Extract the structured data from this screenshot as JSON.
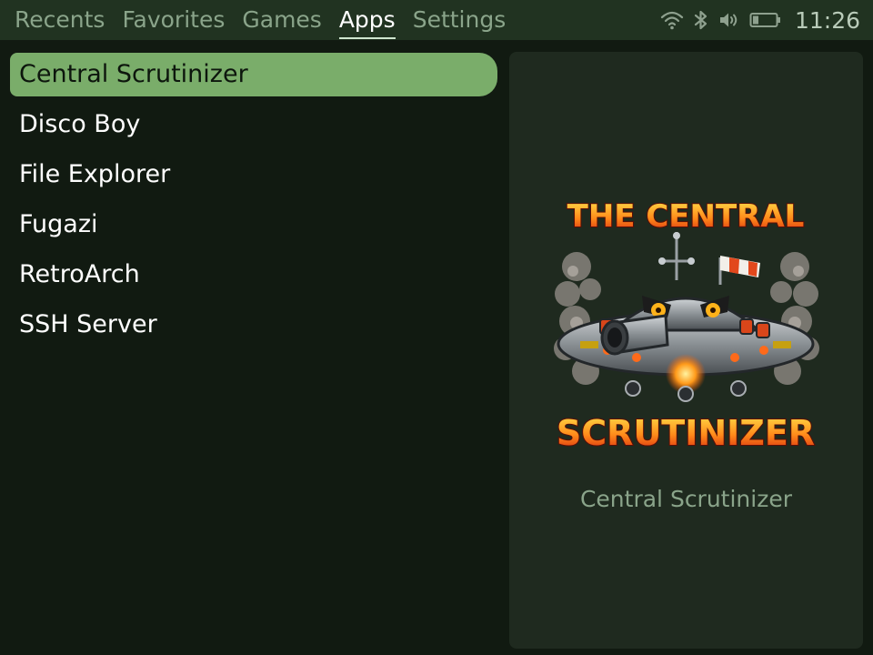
{
  "nav": {
    "tabs": [
      {
        "label": "Recents",
        "active": false
      },
      {
        "label": "Favorites",
        "active": false
      },
      {
        "label": "Games",
        "active": false
      },
      {
        "label": "Apps",
        "active": true
      },
      {
        "label": "Settings",
        "active": false
      }
    ]
  },
  "status": {
    "icons": [
      "wifi-icon",
      "bluetooth-icon",
      "volume-icon",
      "battery-icon"
    ],
    "battery_level": 0.25,
    "time": "11:26"
  },
  "apps": {
    "selected_index": 0,
    "items": [
      {
        "label": "Central Scrutinizer"
      },
      {
        "label": "Disco Boy"
      },
      {
        "label": "File Explorer"
      },
      {
        "label": "Fugazi"
      },
      {
        "label": "RetroArch"
      },
      {
        "label": "SSH Server"
      }
    ]
  },
  "preview": {
    "art_title_top": "THE CENTRAL",
    "art_title_bottom": "SCRUTINIZER",
    "caption": "Central Scrutinizer"
  },
  "colors": {
    "background": "#111a11",
    "topbar": "#213321",
    "selection": "#7aad6a",
    "panel": "#1f2a1f",
    "muted_text": "#8aa48a"
  }
}
